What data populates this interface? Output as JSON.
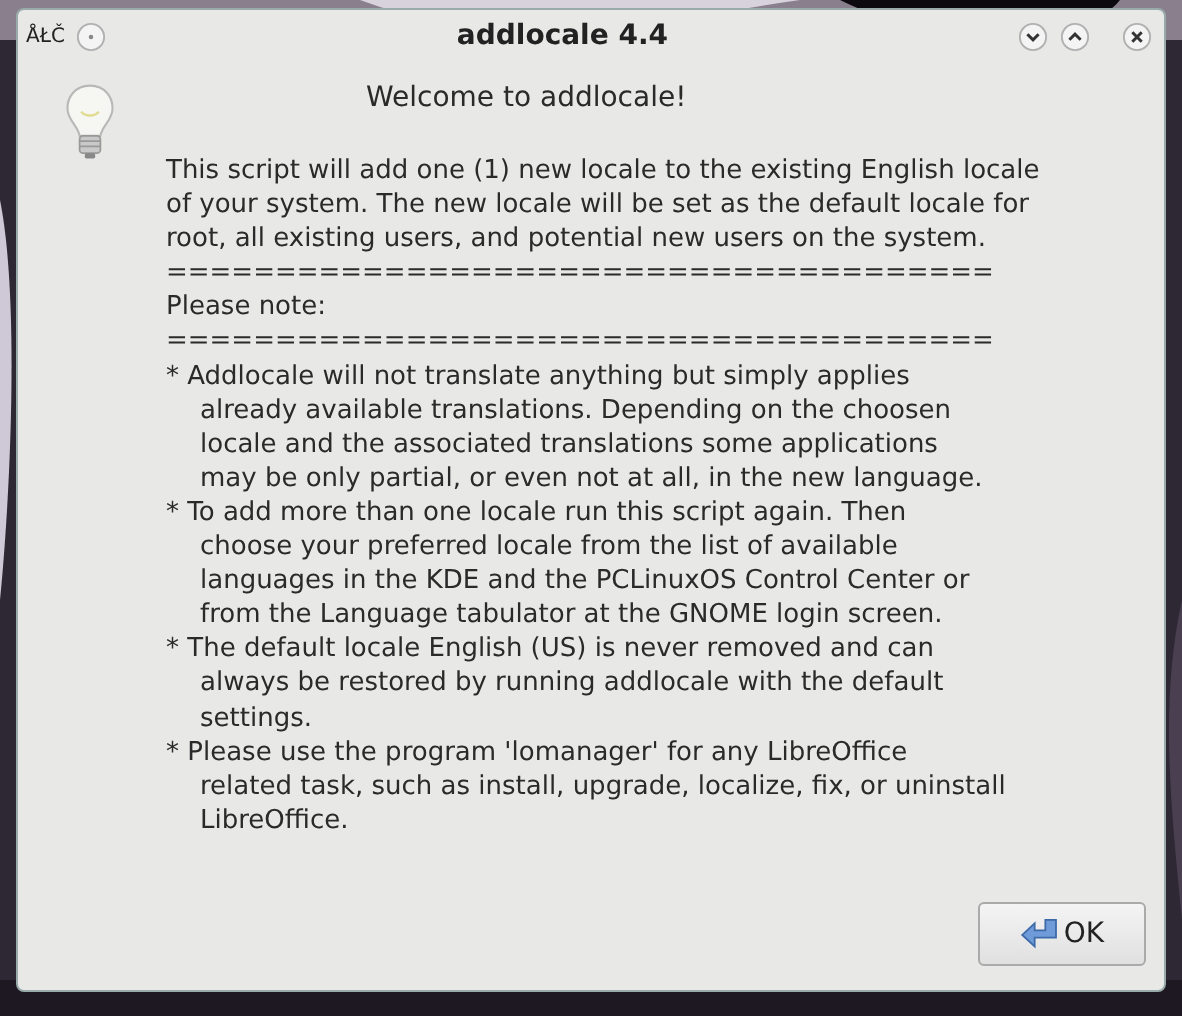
{
  "window": {
    "title": "addlocale 4.4",
    "menu_glyph": "ÅŁČ"
  },
  "heading": "Welcome to addlocale!",
  "lines": [
    {
      "kind": "plain",
      "text": "This script will add one (1) new locale to the existing English locale"
    },
    {
      "kind": "plain",
      "text": "of your system. The new locale will be set as the default locale for"
    },
    {
      "kind": "plain",
      "text": "root, all existing users, and potential new users on the system."
    },
    {
      "kind": "plain",
      "text": "======================================"
    },
    {
      "kind": "plain",
      "text": "Please note:"
    },
    {
      "kind": "plain",
      "text": "======================================"
    },
    {
      "kind": "bullet",
      "text": "* Addlocale will not translate anything but simply applies"
    },
    {
      "kind": "cont",
      "text": "already available translations. Depending on the choosen"
    },
    {
      "kind": "cont",
      "text": "locale and the associated translations some applications"
    },
    {
      "kind": "cont",
      "text": "may be only partial, or even not at all, in the new language."
    },
    {
      "kind": "bullet",
      "text": "* To add more than one locale run this script again. Then"
    },
    {
      "kind": "cont",
      "text": "choose your preferred locale from the list of available"
    },
    {
      "kind": "cont",
      "text": "languages in the KDE and the PCLinuxOS Control Center or"
    },
    {
      "kind": "cont",
      "text": "from the Language tabulator at the GNOME login screen."
    },
    {
      "kind": "bullet",
      "text": "* The default locale English (US) is never removed and can"
    },
    {
      "kind": "cont",
      "text": "always be restored by running addlocale with the default"
    },
    {
      "kind": "cont",
      "text": "settings."
    },
    {
      "kind": "bullet",
      "text": "* Please use the program 'lomanager' for any LibreOffice"
    },
    {
      "kind": "cont",
      "text": "related task, such as install, upgrade, localize, fix, or uninstall"
    },
    {
      "kind": "cont",
      "text": "LibreOffice."
    }
  ],
  "buttons": [
    {
      "label": "OK"
    }
  ]
}
